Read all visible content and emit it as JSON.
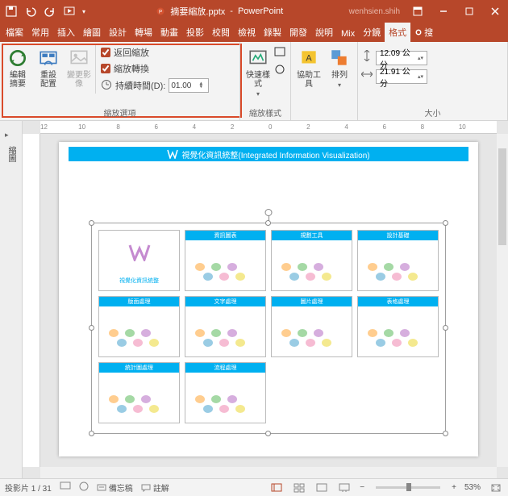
{
  "titlebar": {
    "filename": "摘要縮放.pptx",
    "app": "PowerPoint",
    "user": "wenhsien.shih"
  },
  "tabs": {
    "file": "檔案",
    "home": "常用",
    "insert": "插入",
    "draw": "繪圖",
    "design": "設計",
    "transitions": "轉場",
    "animations": "動畫",
    "slideshow": "投影",
    "review": "校閱",
    "view": "檢視",
    "record": "錄製",
    "developer": "開發",
    "help": "說明",
    "mix": "Mix",
    "split": "分鏡",
    "format": "格式",
    "tell_me": "搜"
  },
  "ribbon": {
    "group_zoom_options": "縮放選項",
    "group_quick_styles": "縮放樣式",
    "group_arrange": "",
    "group_size": "大小",
    "edit_summary": "編輯\n摘要",
    "reset_layout": "重設\n配置",
    "change_image": "變更影\n像",
    "return_zoom": "返回縮放",
    "zoom_transition": "縮放轉換",
    "duration_label": "持續時間(D):",
    "duration_value": "01.00",
    "quick_styles": "快速樣式",
    "assist_tools": "協助工\n具",
    "arrange": "排列",
    "height": "12.09 公分",
    "width": "21.91 公分"
  },
  "thumb_label": "縮圖",
  "slide": {
    "title_text": "視覺化資訊統整(Integrated Information Visualization)",
    "sections": [
      "視覺化資訊統整",
      "資訊圖表",
      "規劃工具",
      "設計基礎",
      "版面處理",
      "文字處理",
      "圖片處理",
      "表格處理",
      "統計圖處理",
      "流程處理"
    ]
  },
  "statusbar": {
    "slide_info": "投影片 1 / 31",
    "notes": "備忘稿",
    "comments": "註解",
    "zoom": "53%"
  },
  "ruler_ticks": [
    "12",
    "10",
    "8",
    "6",
    "4",
    "2",
    "0",
    "2",
    "4",
    "6",
    "8",
    "10",
    "12"
  ]
}
